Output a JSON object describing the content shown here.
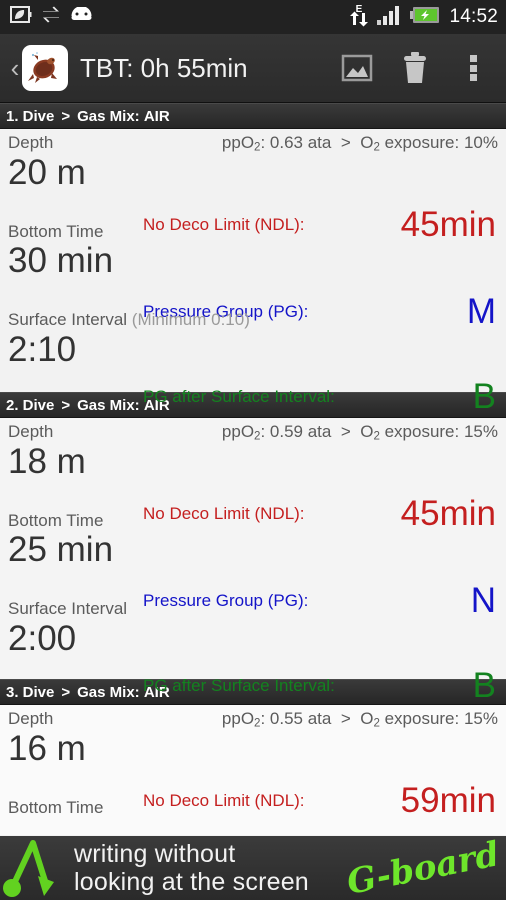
{
  "statusbar": {
    "clock": "14:52",
    "network_label": "E",
    "icons": [
      "battery-saver-leaf-icon",
      "sync-icon",
      "android-head-icon",
      "edge-data-icon",
      "signal-bars-icon",
      "battery-charging-icon"
    ]
  },
  "actionbar": {
    "back_label": "‹",
    "app_icon": "sea-turtle-icon",
    "title": "TBT: 0h 55min",
    "actions": [
      {
        "name": "image-icon",
        "label": "Image"
      },
      {
        "name": "trash-icon",
        "label": "Delete"
      },
      {
        "name": "overflow-menu-icon",
        "label": "More options"
      }
    ]
  },
  "labels": {
    "depth": "Depth",
    "bottom_time": "Bottom Time",
    "surface_interval": "Surface Interval",
    "ndl": "No Deco Limit (NDL):",
    "pg": "Pressure Group (PG):",
    "pg_after_si": "PG after Surface Interval:",
    "gas_mix_prefix": "Gas Mix:",
    "separator": ">"
  },
  "colors": {
    "red": "#c41f1f",
    "blue": "#1414c8",
    "green": "#13821f",
    "header_bg": "#2d2d2d",
    "body_bg": "#f2f2f2",
    "label_gray": "#5b5b5b"
  },
  "dives": [
    {
      "title": "1. Dive",
      "gas_mix": "AIR",
      "ppo2_label": "ppO",
      "ppo2_sub": "2",
      "ppo2_value": ": 0.63 ata",
      "o2_label": "O",
      "o2_sub": "2",
      "o2_value": " exposure: 10%",
      "depth": "20 m",
      "bottom_time": "30 min",
      "surface_interval_note": "(Minimum 0:10)",
      "surface_interval": "2:10",
      "ndl_value": "45min",
      "pg_value": "M",
      "pg_after_value": "B"
    },
    {
      "title": "2. Dive",
      "gas_mix": "AIR",
      "ppo2_label": "ppO",
      "ppo2_sub": "2",
      "ppo2_value": ": 0.59 ata",
      "o2_label": "O",
      "o2_sub": "2",
      "o2_value": " exposure: 15%",
      "depth": "18 m",
      "bottom_time": "25 min",
      "surface_interval_note": "",
      "surface_interval": "2:00",
      "ndl_value": "45min",
      "pg_value": "N",
      "pg_after_value": "B"
    },
    {
      "title": "3. Dive",
      "gas_mix": "AIR",
      "ppo2_label": "ppO",
      "ppo2_sub": "2",
      "ppo2_value": ": 0.55 ata",
      "o2_label": "O",
      "o2_sub": "2",
      "o2_value": " exposure: 15%",
      "depth": "16 m",
      "bottom_time": "",
      "surface_interval_note": "",
      "surface_interval": "",
      "ndl_value": "59min",
      "pg_value": "",
      "pg_after_value": ""
    }
  ],
  "ad": {
    "line1": "writing without",
    "line2": "looking at the screen",
    "brand": "G-board",
    "logo": "green-arrow-logo"
  }
}
